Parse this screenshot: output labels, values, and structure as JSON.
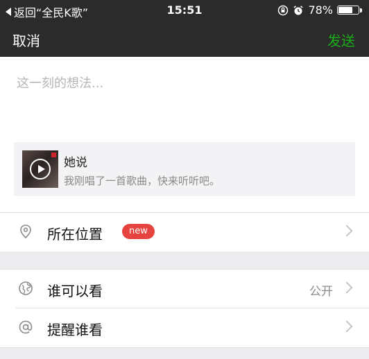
{
  "status_bar": {
    "back_label": "返回“全民K歌”",
    "time": "15:51",
    "battery_text": "78%",
    "battery_level": 0.78
  },
  "nav": {
    "cancel_label": "取消",
    "send_label": "发送"
  },
  "compose": {
    "placeholder": "这一刻的想法..."
  },
  "share_card": {
    "title": "她说",
    "description": "我刚唱了一首歌曲，快来听听吧。"
  },
  "location": {
    "label": "所在位置",
    "badge": "new"
  },
  "visibility": {
    "label": "谁可以看",
    "value": "公开"
  },
  "remind": {
    "label": "提醒谁看"
  },
  "colors": {
    "accent_green": "#1aad19",
    "badge_red": "#e64340",
    "bar_dark": "#2b2b2b"
  }
}
